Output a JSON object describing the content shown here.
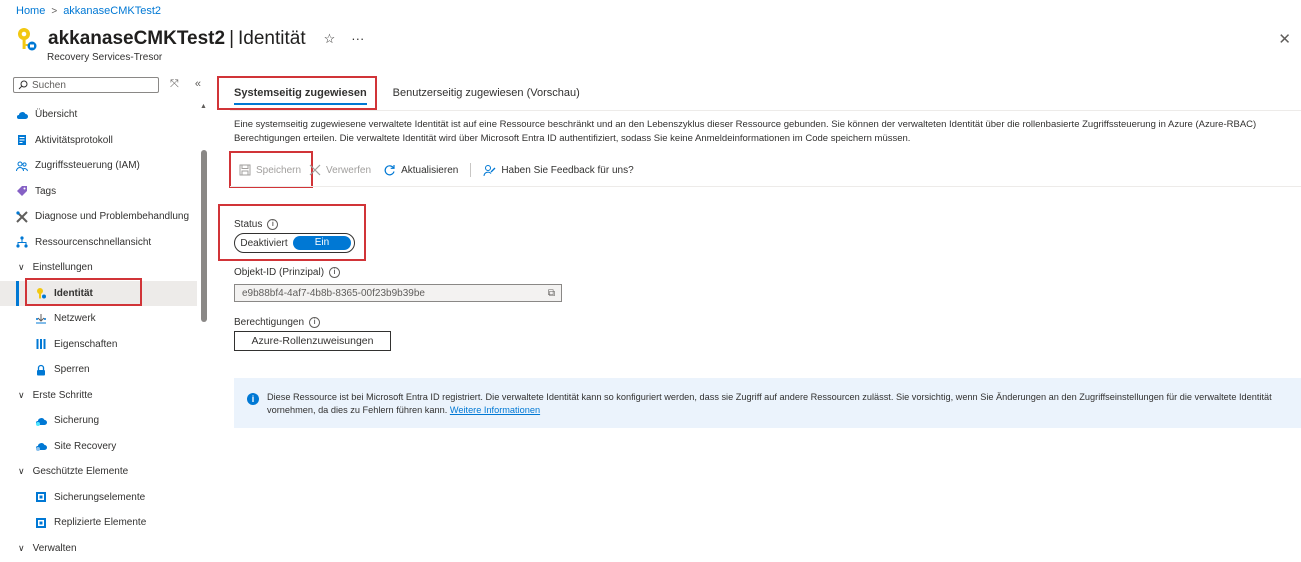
{
  "breadcrumb": {
    "home": "Home",
    "resource": "akkanaseCMKTest2"
  },
  "header": {
    "resource_name": "akkanaseCMKTest2",
    "separator": "|",
    "blade_title": "Identität",
    "subtitle": "Recovery Services-Tresor",
    "star": "☆",
    "more": "···",
    "close": "✕"
  },
  "sidebar": {
    "search_placeholder": "Suchen",
    "items": [
      {
        "label": "Übersicht",
        "icon": "cloud-icon"
      },
      {
        "label": "Aktivitätsprotokoll",
        "icon": "log-icon"
      },
      {
        "label": "Zugriffssteuerung (IAM)",
        "icon": "people-icon"
      },
      {
        "label": "Tags",
        "icon": "tag-icon"
      },
      {
        "label": "Diagnose und Problembehandlung",
        "icon": "wrench-icon"
      },
      {
        "label": "Ressourcenschnellansicht",
        "icon": "hierarchy-icon"
      },
      {
        "label": "Einstellungen",
        "group": true
      },
      {
        "label": "Identität",
        "icon": "key-icon",
        "active": true
      },
      {
        "label": "Netzwerk",
        "icon": "network-icon"
      },
      {
        "label": "Eigenschaften",
        "icon": "properties-icon"
      },
      {
        "label": "Sperren",
        "icon": "lock-icon"
      },
      {
        "label": "Erste Schritte",
        "group": true
      },
      {
        "label": "Sicherung",
        "icon": "backup-icon"
      },
      {
        "label": "Site Recovery",
        "icon": "site-recovery-icon"
      },
      {
        "label": "Geschützte Elemente",
        "group": true
      },
      {
        "label": "Sicherungselemente",
        "icon": "backup-items-icon"
      },
      {
        "label": "Replizierte Elemente",
        "icon": "replicated-items-icon"
      },
      {
        "label": "Verwalten",
        "group": true
      }
    ]
  },
  "tabs": {
    "system": "Systemseitig zugewiesen",
    "user": "Benutzerseitig zugewiesen (Vorschau)"
  },
  "description": "Eine systemseitig zugewiesene verwaltete Identität ist auf eine Ressource beschränkt und an den Lebenszyklus dieser Ressource gebunden. Sie können der verwalteten Identität über die rollenbasierte Zugriffssteuerung in Azure (Azure-RBAC) Berechtigungen erteilen. Die verwaltete Identität wird über Microsoft Entra ID authentifiziert, sodass Sie keine Anmeldeinformationen im Code speichern müssen.",
  "toolbar": {
    "save": "Speichern",
    "discard": "Verwerfen",
    "refresh": "Aktualisieren",
    "feedback": "Haben Sie Feedback für uns?"
  },
  "status": {
    "label": "Status",
    "off": "Deaktiviert",
    "on": "Ein",
    "value": "Ein"
  },
  "object_id": {
    "label": "Objekt-ID (Prinzipal)",
    "value": "e9b88bf4-4af7-4b8b-8365-00f23b9b39be"
  },
  "permissions": {
    "label": "Berechtigungen",
    "button": "Azure-Rollenzuweisungen"
  },
  "infobar": {
    "text": "Diese Ressource ist bei Microsoft Entra ID registriert. Die verwaltete Identität kann so konfiguriert werden, dass sie Zugriff auf andere Ressourcen zulässt. Sie vorsichtig, wenn Sie Änderungen an den Zugriffseinstellungen für die verwaltete Identität vornehmen, da dies zu Fehlern führen kann.",
    "link": "Weitere Informationen"
  },
  "colors": {
    "accent": "#0078d4",
    "highlight": "#d13438"
  }
}
